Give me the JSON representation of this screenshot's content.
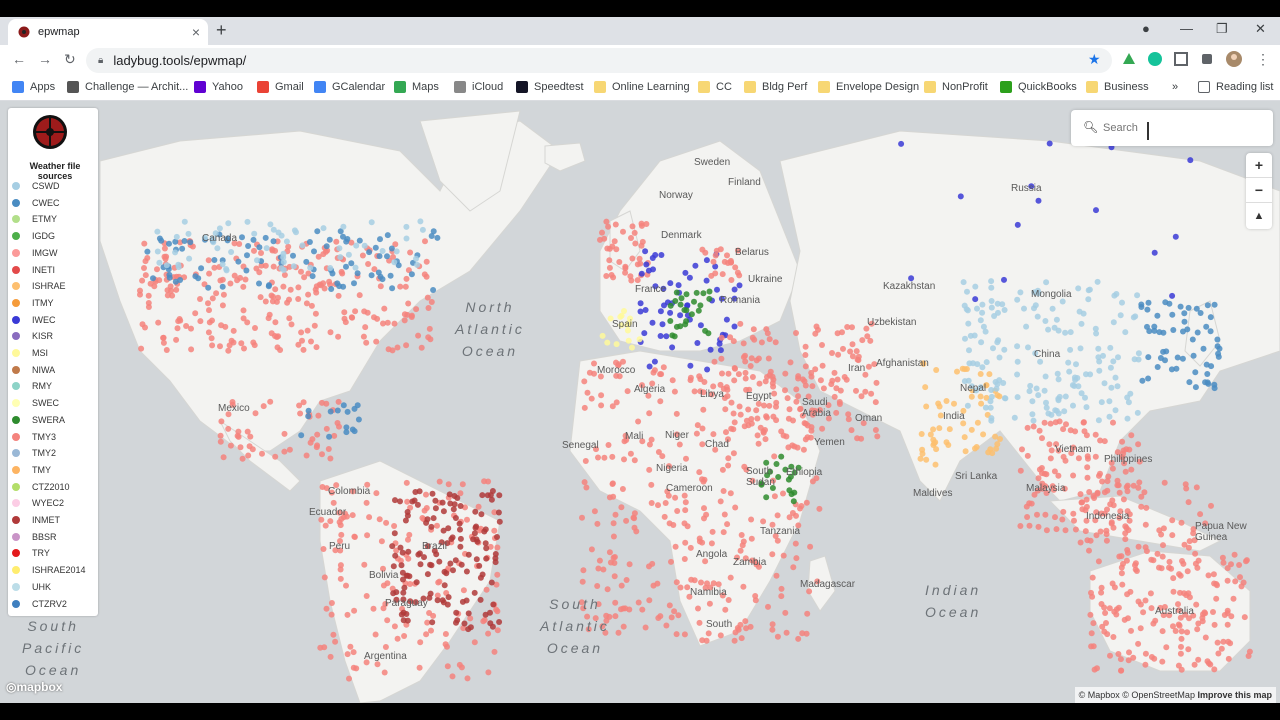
{
  "browser": {
    "tab_title": "epwmap",
    "url": "ladybug.tools/epwmap/",
    "new_tab": "+",
    "close": "×",
    "min": "—",
    "max": "❐",
    "win_close": "✕"
  },
  "bookmarks": [
    {
      "label": "Apps",
      "color": "#4285f4"
    },
    {
      "label": "Challenge — Archit...",
      "color": "#555555"
    },
    {
      "label": "Yahoo",
      "color": "#6001d2"
    },
    {
      "label": "Gmail",
      "color": "#ea4335"
    },
    {
      "label": "GCalendar",
      "color": "#4285f4"
    },
    {
      "label": "Maps",
      "color": "#34a853"
    },
    {
      "label": "iCloud",
      "color": "#888888"
    },
    {
      "label": "Speedtest",
      "color": "#141526"
    },
    {
      "label": "Online Learning",
      "color": "#f7d774"
    },
    {
      "label": "CC",
      "color": "#f7d774"
    },
    {
      "label": "Bldg Perf",
      "color": "#f7d774"
    },
    {
      "label": "Envelope Design",
      "color": "#f7d774"
    },
    {
      "label": "NonProfit",
      "color": "#f7d774"
    },
    {
      "label": "QuickBooks",
      "color": "#2ca01c"
    },
    {
      "label": "Business",
      "color": "#f7d774"
    }
  ],
  "bookmarks_more": "»",
  "reading_list": "Reading list",
  "legend": {
    "title": "Weather file sources",
    "items": [
      {
        "label": "CSWD",
        "color": "#a6cee3"
      },
      {
        "label": "CWEC",
        "color": "#4a8cc2"
      },
      {
        "label": "ETMY",
        "color": "#b2df8a"
      },
      {
        "label": "IGDG",
        "color": "#4daf4a"
      },
      {
        "label": "IMGW",
        "color": "#fb9a99"
      },
      {
        "label": "INETI",
        "color": "#e34a4a"
      },
      {
        "label": "ISHRAE",
        "color": "#fdbf6f"
      },
      {
        "label": "ITMY",
        "color": "#f59b3a"
      },
      {
        "label": "IWEC",
        "color": "#3a3ad6"
      },
      {
        "label": "KISR",
        "color": "#8a6cbf"
      },
      {
        "label": "MSI",
        "color": "#fff99a"
      },
      {
        "label": "NIWA",
        "color": "#c07a4a"
      },
      {
        "label": "RMY",
        "color": "#8dd3c7"
      },
      {
        "label": "SWEC",
        "color": "#ffffb3"
      },
      {
        "label": "SWERA",
        "color": "#2e8b2e"
      },
      {
        "label": "TMY3",
        "color": "#f4837d"
      },
      {
        "label": "TMY2",
        "color": "#9ab8d6"
      },
      {
        "label": "TMY",
        "color": "#fdb462"
      },
      {
        "label": "CTZ2010",
        "color": "#b3de69"
      },
      {
        "label": "WYEC2",
        "color": "#fccde5"
      },
      {
        "label": "INMET",
        "color": "#b03a3a"
      },
      {
        "label": "BBSR",
        "color": "#c994c7"
      },
      {
        "label": "TRY",
        "color": "#e31a1c"
      },
      {
        "label": "ISHRAE2014",
        "color": "#ffed6f"
      },
      {
        "label": "UHK",
        "color": "#bcdde8"
      },
      {
        "label": "CTZRV2",
        "color": "#3f7fbf"
      }
    ]
  },
  "search": {
    "placeholder": "Search"
  },
  "zoom": {
    "in": "+",
    "out": "−",
    "compass": "▲"
  },
  "map_labels": {
    "sweden": "Sweden",
    "finland": "Finland",
    "norway": "Norway",
    "russia": "Russia",
    "canada": "Canada",
    "denmark": "Denmark",
    "belarus": "Belarus",
    "ukraine": "Ukraine",
    "romania": "Romania",
    "france": "France",
    "spain": "Spain",
    "kazakhstan": "Kazakhstan",
    "mongolia": "Mongolia",
    "uzbekistan": "Uzbekistan",
    "china": "China",
    "morocco": "Morocco",
    "algeria": "Algeria",
    "libya": "Libya",
    "egypt": "Egypt",
    "saudi": "Saudi\nArabia",
    "iran": "Iran",
    "oman": "Oman",
    "afghanistan": "Afghanistan",
    "nepal": "Nepal",
    "india": "India",
    "mexico": "Mexico",
    "mali": "Mali",
    "niger": "Niger",
    "chad": "Chad",
    "senegal": "Senegal",
    "nigeria": "Nigeria",
    "cameroon": "Cameroon",
    "sudan": "South\nSudan",
    "ethiopia": "Ethiopia",
    "yemen": "Yemen",
    "srilanka": "Sri Lanka",
    "maldives": "Maldives",
    "vietnam": "Vietnam",
    "philippines": "Philippines",
    "malaysia": "Malaysia",
    "indonesia": "Indonesia",
    "png": "Papua New\nGuinea",
    "colombia": "Colombia",
    "ecuador": "Ecuador",
    "peru": "Peru",
    "brazil": "Brazil",
    "bolivia": "Bolivia",
    "paraguay": "Paraguay",
    "argentina": "Argentina",
    "tanzania": "Tanzania",
    "angola": "Angola",
    "zambia": "Zambia",
    "namibia": "Namibia",
    "madagascar": "Madagascar",
    "southafrica": "South",
    "australia": "Australia"
  },
  "oceans": {
    "north_atlantic": "North\nAtlantic\nOcean",
    "south_atlantic": "South\nAtlantic\nOcean",
    "indian": "Indian\nOcean",
    "south_pacific": "South\nPacific\nOcean"
  },
  "mapbox_logo": "◎mapbox",
  "attribution": {
    "text": "© Mapbox © OpenStreetMap",
    "improve": "Improve this map"
  }
}
